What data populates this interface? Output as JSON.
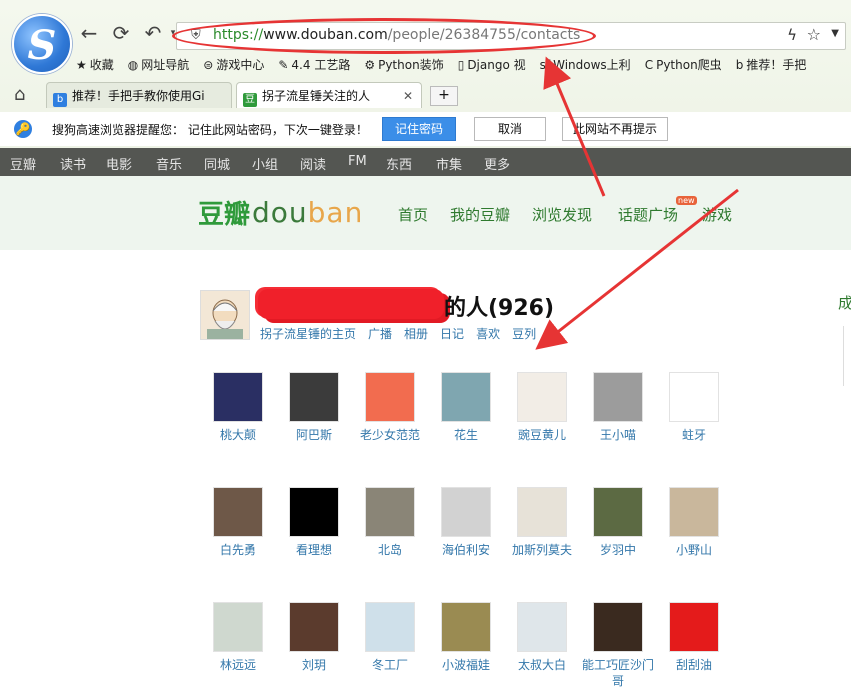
{
  "browser": {
    "logo_letter": "S",
    "url": {
      "scheme": "https://",
      "host": "www.douban.com",
      "path": "/people/26384755/contacts"
    },
    "bookmarks": [
      {
        "icon": "star-icon",
        "glyph": "★",
        "label": "收藏"
      },
      {
        "icon": "globe-icon",
        "glyph": "◍",
        "label": "网址导航"
      },
      {
        "icon": "game-icon",
        "glyph": "⊜",
        "label": "游戏中心"
      },
      {
        "icon": "craft-icon",
        "glyph": "✎",
        "label": "4.4 工艺路"
      },
      {
        "icon": "python-icon",
        "glyph": "⚙",
        "label": "Python装饰"
      },
      {
        "icon": "doc-icon",
        "glyph": "▯",
        "label": "Django 视"
      },
      {
        "icon": "sf-icon",
        "glyph": "sf",
        "label": "Windows上利"
      },
      {
        "icon": "c-icon",
        "glyph": "C",
        "label": "Python爬虫"
      },
      {
        "icon": "b-icon",
        "glyph": "b",
        "label": "推荐！手把"
      }
    ],
    "tabs": [
      {
        "label": "推荐！手把手教你使用Gi",
        "favicon": "b"
      },
      {
        "label": "拐子流星锤关注的人",
        "favicon": "豆"
      }
    ],
    "notice": {
      "message": "搜狗高速浏览器提醒您： 记住此网站密码，下次一键登录！",
      "save": "记住密码",
      "cancel": "取消",
      "never": "此网站不再提示"
    }
  },
  "douban": {
    "topnav": [
      "豆瓣",
      "读书",
      "电影",
      "音乐",
      "同城",
      "小组",
      "阅读",
      "FM",
      "东西",
      "市集",
      "更多"
    ],
    "brand_cn": "豆瓣",
    "brand_en_a": "dou",
    "brand_en_b": "ban",
    "mainnav": [
      "首页",
      "我的豆瓣",
      "浏览发现",
      "话题广场",
      "游戏"
    ],
    "new_badge": "new",
    "heading_suffix": "的人(926)",
    "sublinks": [
      "拐子流星锤的主页",
      "广播",
      "相册",
      "日记",
      "喜欢",
      "豆列"
    ],
    "edge_char": "成"
  },
  "contacts": [
    {
      "name": "桃大颠",
      "color": "#2a2f63"
    },
    {
      "name": "阿巴斯",
      "color": "#3b3b3b"
    },
    {
      "name": "老少女范范",
      "color": "#f26c4f"
    },
    {
      "name": "花生",
      "color": "#7fa6b0"
    },
    {
      "name": "豌豆黄儿",
      "color": "#f2ede6"
    },
    {
      "name": "王小喵",
      "color": "#9c9c9c"
    },
    {
      "name": "蛀牙",
      "color": "#ffffff"
    },
    {
      "name": "白先勇",
      "color": "#6e5848"
    },
    {
      "name": "看理想",
      "color": "#000000"
    },
    {
      "name": "北岛",
      "color": "#8a8577"
    },
    {
      "name": "海伯利安",
      "color": "#d2d2d2"
    },
    {
      "name": "加斯列莫夫",
      "color": "#e7e2d8"
    },
    {
      "name": "岁羽中",
      "color": "#5c6a43"
    },
    {
      "name": "小野山",
      "color": "#c9b79c"
    },
    {
      "name": "林远远",
      "color": "#cfd8cf"
    },
    {
      "name": "刘玥",
      "color": "#5b3b2d"
    },
    {
      "name": "冬工厂",
      "color": "#cfe0ea"
    },
    {
      "name": "小波福娃",
      "color": "#9a8b52"
    },
    {
      "name": "太叔大白",
      "color": "#dfe6ea"
    },
    {
      "name": "能工巧匠沙门哥",
      "color": "#3a2a1f"
    },
    {
      "name": "刮刮油",
      "color": "#e41b1b"
    }
  ],
  "colors": {
    "annotation": "#e63434",
    "link": "#3377aa",
    "douban_green": "#2f9a3b"
  }
}
